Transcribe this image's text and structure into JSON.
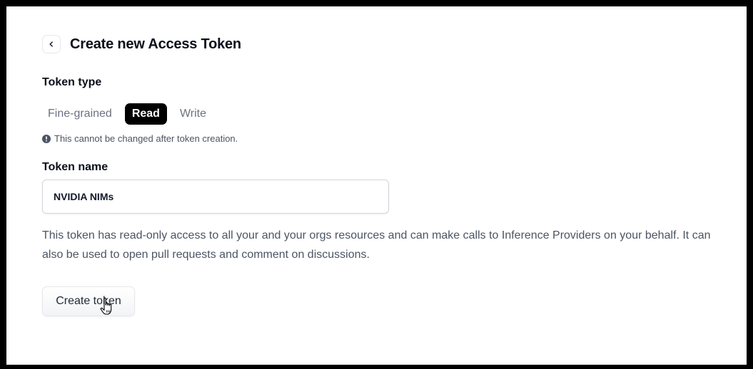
{
  "page": {
    "title": "Create new Access Token",
    "back_icon": "chevron-left-icon"
  },
  "token_type": {
    "label": "Token type",
    "options": [
      "Fine-grained",
      "Read",
      "Write"
    ],
    "selected": "Read",
    "note_icon": "info-icon",
    "note": "This cannot be changed after token creation."
  },
  "token_name": {
    "label": "Token name",
    "value": "NVIDIA NIMs"
  },
  "description": "This token has read-only access to all your and your orgs resources and can make calls to Inference Providers on your behalf. It can also be used to open pull requests and comment on discussions.",
  "actions": {
    "create_label": "Create token"
  },
  "colors": {
    "selected_bg": "#000000",
    "selected_text": "#ffffff",
    "muted_text": "#6b7280",
    "frame": "#000000"
  }
}
